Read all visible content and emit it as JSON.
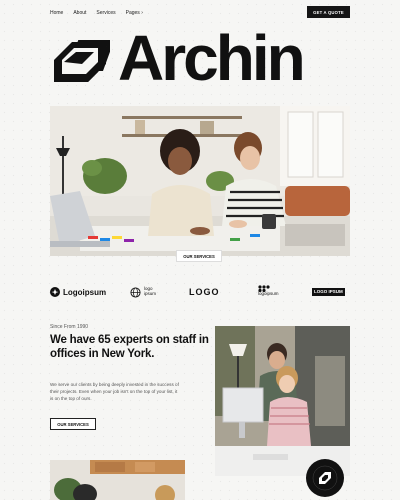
{
  "nav": {
    "items": [
      "Home",
      "About",
      "Services",
      "Pages"
    ],
    "cta": "GET A QUOTE"
  },
  "brand": {
    "name": "Archin",
    "logo_icon": "stacked-layers-icon"
  },
  "hero": {
    "button": "OUR SERVICES"
  },
  "logos": {
    "items": [
      {
        "text": "Logoipsum",
        "icon": "circle-star-icon"
      },
      {
        "text": "logo ipsum",
        "icon": "globe-icon"
      },
      {
        "text": "LOGO",
        "icon": "bracket-icon"
      },
      {
        "text": "logoipsum",
        "icon": "dots-grid-icon"
      },
      {
        "text": "LOGO IPSUM",
        "icon": "box-icon"
      }
    ]
  },
  "about": {
    "since": "Since From 1990",
    "headline": "We have 65 experts on staff in offices in New York.",
    "body": "We serve our clients by being deeply invested in the success of their projects. Even when your job isn't on the top of your list, it is on the top of ours.",
    "button": "OUR SERVICES"
  },
  "colors": {
    "background": "#f6f6f4",
    "dark": "#151515"
  }
}
